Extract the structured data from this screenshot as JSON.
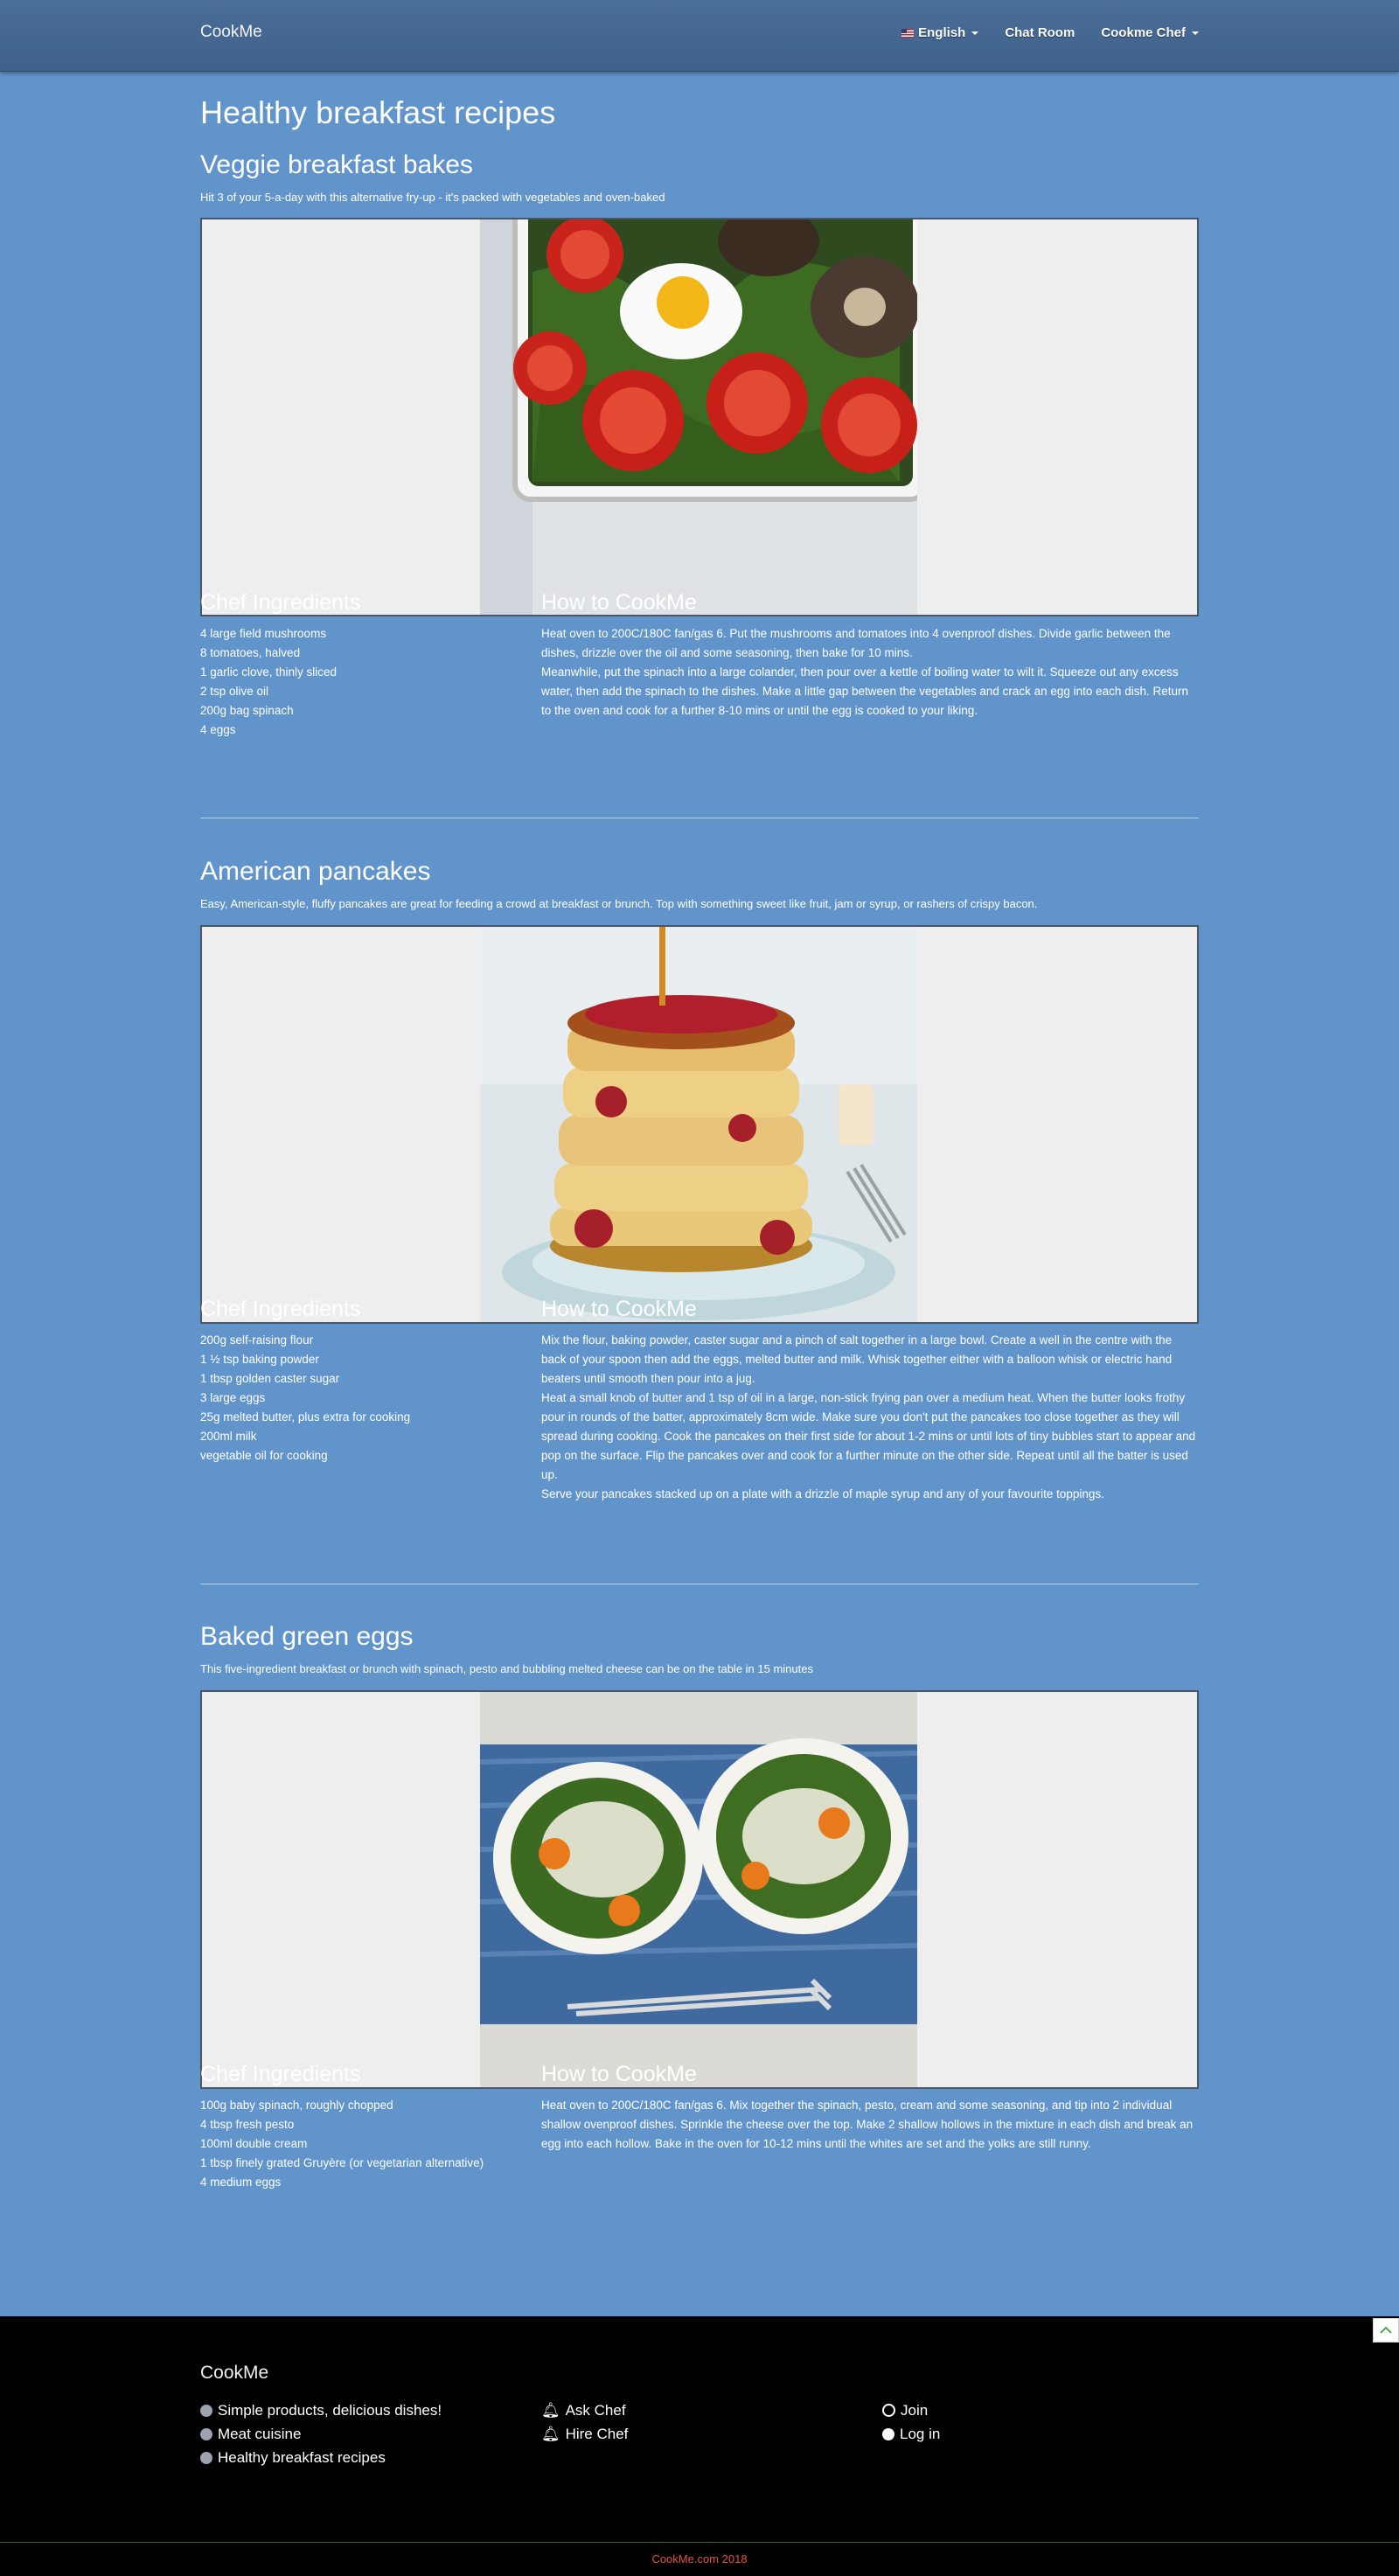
{
  "nav": {
    "brand": "CookMe",
    "language": "English",
    "chat_room": "Chat Room",
    "chef_menu": "Cookme Chef"
  },
  "page_title": "Healthy breakfast recipes",
  "recipes": [
    {
      "title": "Veggie breakfast bakes",
      "description": "Hit 3 of your 5-a-day with this alternative fry-up - it's packed with vegetables and oven-baked",
      "ingredients_heading": "Chef Ingredients",
      "ingredients": [
        "4 large field mushrooms",
        "8 tomatoes, halved",
        "1 garlic clove, thinly sliced",
        "2 tsp olive oil",
        "200g bag spinach",
        "4 eggs"
      ],
      "method_heading": "How to CookMe",
      "method": [
        "Heat oven to 200C/180C fan/gas 6. Put the mushrooms and tomatoes into 4 ovenproof dishes. Divide garlic between the dishes, drizzle over the oil and some seasoning, then bake for 10 mins.",
        "Meanwhile, put the spinach into a large colander, then pour over a kettle of boiling water to wilt it. Squeeze out any excess water, then add the spinach to the dishes. Make a little gap between the vegetables and crack an egg into each dish. Return to the oven and cook for a further 8-10 mins or until the egg is cooked to your liking."
      ]
    },
    {
      "title": "American pancakes",
      "description": "Easy, American-style, fluffy pancakes are great for feeding a crowd at breakfast or brunch. Top with something sweet like fruit, jam or syrup, or rashers of crispy bacon.",
      "ingredients_heading": "Chef Ingredients",
      "ingredients": [
        "200g self-raising flour",
        "1 ½ tsp baking powder",
        "1 tbsp golden caster sugar",
        "3 large eggs",
        "25g melted butter, plus extra for cooking",
        "200ml milk",
        "vegetable oil for cooking"
      ],
      "method_heading": "How to CookMe",
      "method": [
        "Mix the flour, baking powder, caster sugar and a pinch of salt together in a large bowl. Create a well in the centre with the back of your spoon then add the eggs, melted butter and milk. Whisk together either with a balloon whisk or electric hand beaters until smooth then pour into a jug.",
        "Heat a small knob of butter and 1 tsp of oil in a large, non-stick frying pan over a medium heat. When the butter looks frothy pour in rounds of the batter, approximately 8cm wide. Make sure you don't put the pancakes too close together as they will spread during cooking. Cook the pancakes on their first side for about 1-2 mins or until lots of tiny bubbles start to appear and pop on the surface. Flip the pancakes over and cook for a further minute on the other side. Repeat until all the batter is used up.",
        "Serve your pancakes stacked up on a plate with a drizzle of maple syrup and any of your favourite toppings."
      ]
    },
    {
      "title": "Baked green eggs",
      "description": "This five-ingredient breakfast or brunch with spinach, pesto and bubbling melted cheese can be on the table in 15 minutes",
      "ingredients_heading": "Chef Ingredients",
      "ingredients": [
        "100g baby spinach, roughly chopped",
        "4 tbsp fresh pesto",
        "100ml double cream",
        "1 tbsp finely grated Gruyère (or vegetarian alternative)",
        "4 medium eggs"
      ],
      "method_heading": "How to CookMe",
      "method": [
        "Heat oven to 200C/180C fan/gas 6. Mix together the spinach, pesto, cream and some seasoning, and tip into 2 individual shallow ovenproof dishes. Sprinkle the cheese over the top. Make 2 shallow hollows in the mixture in each dish and break an egg into each hollow. Bake in the oven for 10-12 mins until the whites are set and the yolks are still runny."
      ]
    }
  ],
  "footer": {
    "brand": "CookMe",
    "links_col1": [
      "Simple products, delicious dishes!",
      "Meat cuisine",
      "Healthy breakfast recipes"
    ],
    "links_col2": [
      "Ask Chef",
      "Hire Chef"
    ],
    "links_col3": [
      "Join",
      "Log in"
    ],
    "copyright": "CookMe.com 2018"
  }
}
